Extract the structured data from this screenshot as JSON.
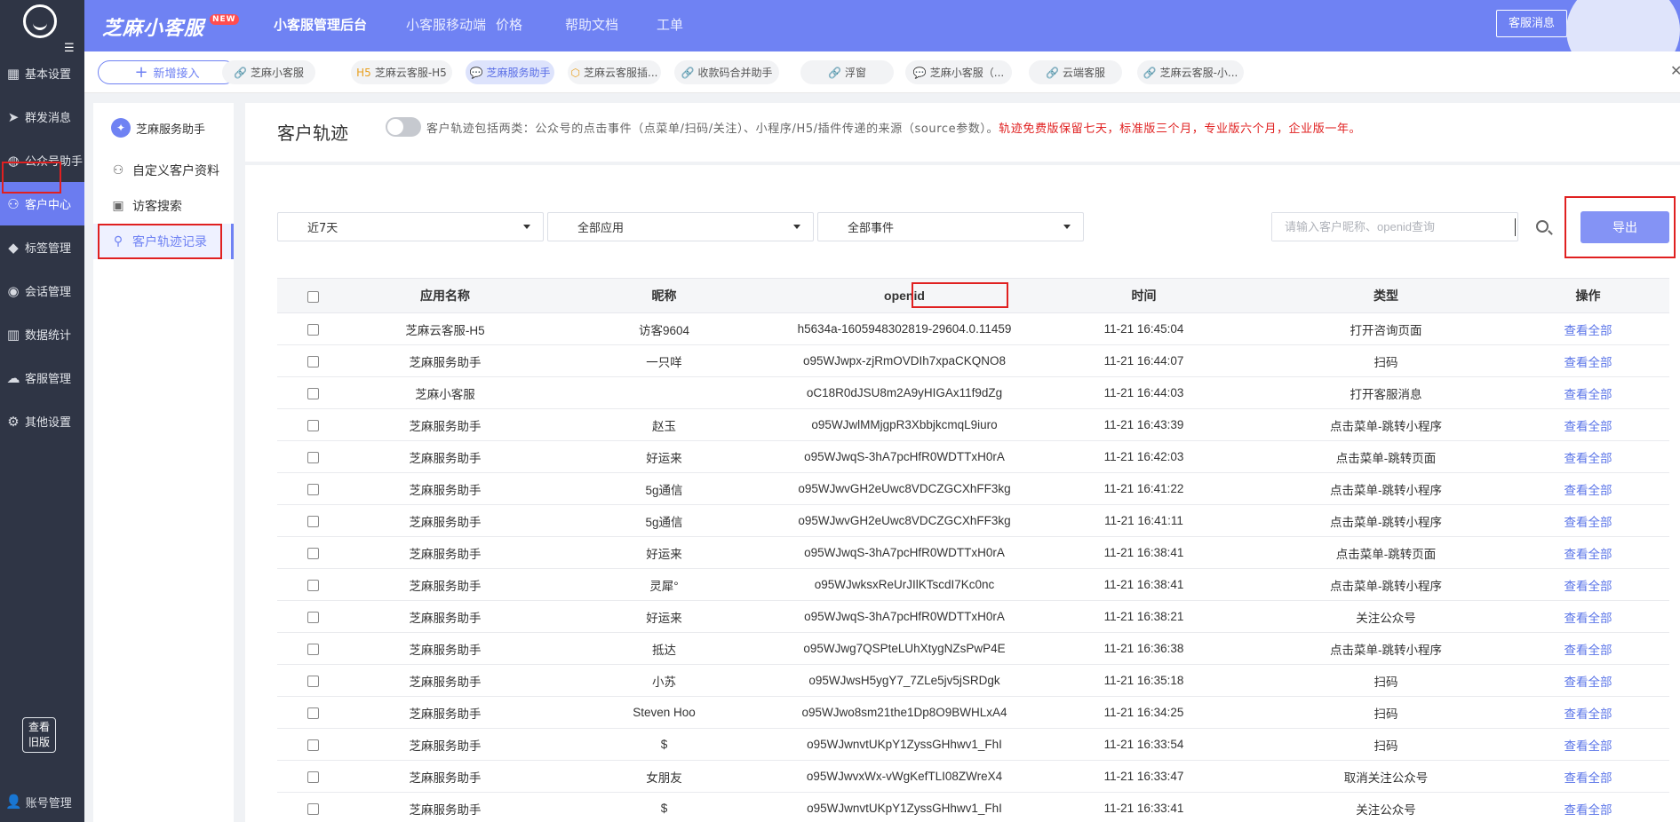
{
  "sidebar": {
    "items": [
      {
        "label": "基本设置",
        "icon": "grid-icon"
      },
      {
        "label": "群发消息",
        "icon": "send-icon"
      },
      {
        "label": "公众号助手",
        "icon": "wechat-icon"
      },
      {
        "label": "客户中心",
        "icon": "users-icon"
      },
      {
        "label": "标签管理",
        "icon": "tag-icon"
      },
      {
        "label": "会话管理",
        "icon": "chat-icon"
      },
      {
        "label": "数据统计",
        "icon": "bar-chart-icon"
      },
      {
        "label": "客服管理",
        "icon": "service-icon"
      },
      {
        "label": "其他设置",
        "icon": "gear-icon"
      }
    ],
    "old_version_line1": "查看",
    "old_version_line2": "旧版",
    "account": "账号管理"
  },
  "header": {
    "brand": "芝麻小客服",
    "new_badge": "NEW",
    "nav": [
      "小客服管理后台",
      "小客服移动端",
      "价格",
      "帮助文档",
      "工单"
    ],
    "message_button": "客服消息"
  },
  "tabs": {
    "add_button": "新增接入",
    "items": [
      {
        "label": "芝麻小客服",
        "prefix": "🔗"
      },
      {
        "label": "芝麻云客服-H5",
        "prefix": "H5"
      },
      {
        "label": "芝麻服务助手",
        "prefix": "💬"
      },
      {
        "label": "芝麻云客服插...",
        "prefix": "⬡"
      },
      {
        "label": "收款码合并助手",
        "prefix": "🔗"
      },
      {
        "label": "浮窗",
        "prefix": "🔗"
      },
      {
        "label": "芝麻小客服（...",
        "prefix": "💬"
      },
      {
        "label": "云端客服",
        "prefix": "🔗"
      },
      {
        "label": "芝麻云客服-小...",
        "prefix": "🔗"
      }
    ]
  },
  "subnav": {
    "title": "芝麻服务助手",
    "items": [
      "自定义客户资料",
      "访客搜索",
      "客户轨迹记录"
    ]
  },
  "page": {
    "title": "客户轨迹",
    "desc": "客户轨迹包括两类：公众号的点击事件（点菜单/扫码/关注）、小程序/H5/插件传递的来源（source参数）。",
    "desc_red": "轨迹免费版保留七天，标准版三个月，专业版六个月，企业版一年。"
  },
  "filters": {
    "time": "近7天",
    "app": "全部应用",
    "event": "全部事件",
    "search_placeholder": "请输入客户昵称、openid查询",
    "export": "导出"
  },
  "table": {
    "headers": [
      "应用名称",
      "昵称",
      "openid",
      "时间",
      "类型",
      "操作"
    ],
    "action_label": "查看全部",
    "rows": [
      [
        "芝麻云客服-H5",
        "访客9604",
        "h5634a-1605948302819-29604.0.11459",
        "11-21 16:45:04",
        "打开咨询页面"
      ],
      [
        "芝麻服务助手",
        "一只咩",
        "o95WJwpx-zjRmOVDIh7xpaCKQNO8",
        "11-21 16:44:07",
        "扫码"
      ],
      [
        "芝麻小客服",
        "",
        "oC18R0dJSU8m2A9yHIGAx11f9dZg",
        "11-21 16:44:03",
        "打开客服消息"
      ],
      [
        "芝麻服务助手",
        "赵玉",
        "o95WJwlMMjgpR3XbbjkcmqL9iuro",
        "11-21 16:43:39",
        "点击菜单-跳转小程序"
      ],
      [
        "芝麻服务助手",
        "好运来",
        "o95WJwqS-3hA7pcHfR0WDTTxH0rA",
        "11-21 16:42:03",
        "点击菜单-跳转页面"
      ],
      [
        "芝麻服务助手",
        "5g通信",
        "o95WJwvGH2eUwc8VDCZGCXhFF3kg",
        "11-21 16:41:22",
        "点击菜单-跳转小程序"
      ],
      [
        "芝麻服务助手",
        "5g通信",
        "o95WJwvGH2eUwc8VDCZGCXhFF3kg",
        "11-21 16:41:11",
        "点击菜单-跳转小程序"
      ],
      [
        "芝麻服务助手",
        "好运来",
        "o95WJwqS-3hA7pcHfR0WDTTxH0rA",
        "11-21 16:38:41",
        "点击菜单-跳转页面"
      ],
      [
        "芝麻服务助手",
        "灵犀°",
        "o95WJwksxReUrJIlKTscdI7Kc0nc",
        "11-21 16:38:41",
        "点击菜单-跳转小程序"
      ],
      [
        "芝麻服务助手",
        "好运来",
        "o95WJwqS-3hA7pcHfR0WDTTxH0rA",
        "11-21 16:38:21",
        "关注公众号"
      ],
      [
        "芝麻服务助手",
        "抵达",
        "o95WJwg7QSPteLUhXtygNZsPwP4E",
        "11-21 16:36:38",
        "点击菜单-跳转小程序"
      ],
      [
        "芝麻服务助手",
        "小苏",
        "o95WJwsH5ygY7_7ZLe5jv5jSRDgk",
        "11-21 16:35:18",
        "扫码"
      ],
      [
        "芝麻服务助手",
        "Steven Hoo",
        "o95WJwo8sm21the1Dp8O9BWHLxA4",
        "11-21 16:34:25",
        "扫码"
      ],
      [
        "芝麻服务助手",
        "$",
        "o95WJwnvtUKpY1ZyssGHhwv1_FhI",
        "11-21 16:33:54",
        "扫码"
      ],
      [
        "芝麻服务助手",
        "女朋友",
        "o95WJwvxWx-vWgKefTLI08ZWreX4",
        "11-21 16:33:47",
        "取消关注公众号"
      ],
      [
        "芝麻服务助手",
        "$",
        "o95WJwnvtUKpY1ZyssGHhwv1_FhI",
        "11-21 16:33:41",
        "关注公众号"
      ]
    ]
  },
  "colors": {
    "accent": "#6f82f3",
    "sidebar_bg": "#2f3545",
    "highlight_red": "#e02020"
  }
}
